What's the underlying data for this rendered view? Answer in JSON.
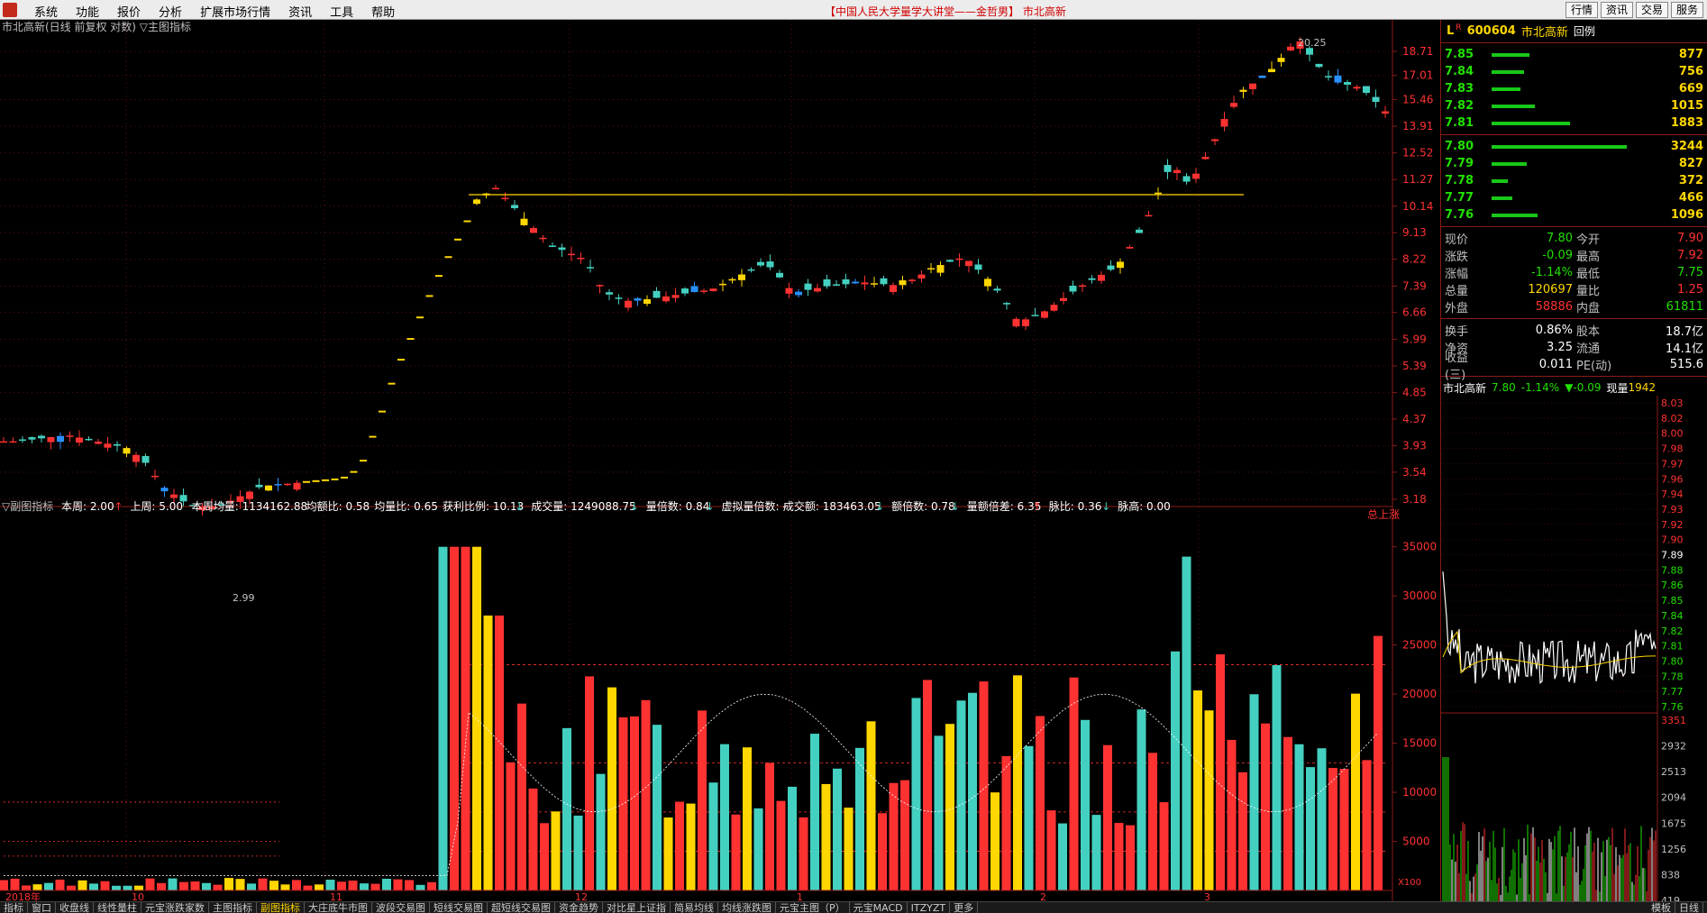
{
  "menubar": {
    "items": [
      "系统",
      "功能",
      "报价",
      "分析",
      "扩展市场行情",
      "资讯",
      "工具",
      "帮助"
    ],
    "title": "【中国人民大学量学大讲堂——金哲男】 市北高新",
    "right_buttons": [
      "行情",
      "资讯",
      "交易",
      "服务"
    ]
  },
  "main_chart": {
    "header": "市北高新(日线 前复权 对数) ▽主图指标",
    "high_label": "20.25",
    "low_label": "2.99",
    "price_ticks": [
      "18.71",
      "17.01",
      "15.46",
      "13.91",
      "12.52",
      "11.27",
      "10.14",
      "9.13",
      "8.22",
      "7.39",
      "6.66",
      "5.99",
      "5.39",
      "4.85",
      "4.37",
      "3.93",
      "3.54",
      "3.18"
    ],
    "date_labels": [
      "2018年",
      "10",
      "11",
      "12",
      "1",
      "2",
      "3"
    ]
  },
  "sub_chart": {
    "header_name": "▽副图指标",
    "header_items": [
      {
        "text": "本周: 2.00",
        "mark": "↑",
        "color": "#ffffff"
      },
      {
        "text": "上周: 5.00",
        "mark": "",
        "color": "#ffffff"
      },
      {
        "text": "本周均量: 1134162.88",
        "mark": "",
        "color": "#ffffff"
      },
      {
        "text": "均额比: 0.58",
        "mark": "",
        "color": "#ffffff"
      },
      {
        "text": "均量比: 0.65",
        "mark": "",
        "color": "#ffffff"
      },
      {
        "text": "获利比例: 10.13",
        "mark": "↓",
        "color": "#ffffff"
      },
      {
        "text": "成交量: 1249088.75",
        "mark": "↓",
        "color": "#ffffff"
      },
      {
        "text": "量倍数: 0.84",
        "mark": "↓",
        "color": "#ffffff"
      },
      {
        "text": "虚拟量倍数: -",
        "mark": "",
        "color": "#ffffff"
      },
      {
        "text": "成交额: 183463.05",
        "mark": "↓",
        "color": "#ffffff"
      },
      {
        "text": "额倍数: 0.78",
        "mark": "↓",
        "color": "#ffffff"
      },
      {
        "text": "量额倍差: 6.35",
        "mark": "↑",
        "color": "#ffffff"
      },
      {
        "text": "脉比: 0.36",
        "mark": "↓",
        "color": "#ffffff"
      },
      {
        "text": "脉高: 0.00",
        "mark": "",
        "color": "#ffffff"
      }
    ],
    "corner_label": "总上涨",
    "vol_ticks": [
      "35000",
      "30000",
      "25000",
      "20000",
      "15000",
      "10000",
      "5000"
    ],
    "unit_label": "X100"
  },
  "quote": {
    "market_flag": "L",
    "r_flag": "R",
    "code": "600604",
    "name": "市北高新",
    "mode": "回例",
    "asks": [
      {
        "price": "7.85",
        "vol": "877",
        "bar": 0.28
      },
      {
        "price": "7.84",
        "vol": "756",
        "bar": 0.24
      },
      {
        "price": "7.83",
        "vol": "669",
        "bar": 0.21
      },
      {
        "price": "7.82",
        "vol": "1015",
        "bar": 0.32
      },
      {
        "price": "7.81",
        "vol": "1883",
        "bar": 0.58
      }
    ],
    "bids": [
      {
        "price": "7.80",
        "vol": "3244",
        "bar": 1.0
      },
      {
        "price": "7.79",
        "vol": "827",
        "bar": 0.26
      },
      {
        "price": "7.78",
        "vol": "372",
        "bar": 0.12
      },
      {
        "price": "7.77",
        "vol": "466",
        "bar": 0.15
      },
      {
        "price": "7.76",
        "vol": "1096",
        "bar": 0.34
      }
    ],
    "stats1": [
      {
        "k": "现价",
        "v": "7.80",
        "vc": "grn",
        "k2": "今开",
        "v2": "7.90",
        "v2c": "red"
      },
      {
        "k": "涨跌",
        "v": "-0.09",
        "vc": "grn",
        "k2": "最高",
        "v2": "7.92",
        "v2c": "red"
      },
      {
        "k": "涨幅",
        "v": "-1.14%",
        "vc": "grn",
        "k2": "最低",
        "v2": "7.75",
        "v2c": "grn"
      },
      {
        "k": "总量",
        "v": "120697",
        "vc": "yel",
        "k2": "量比",
        "v2": "1.25",
        "v2c": "red"
      },
      {
        "k": "外盘",
        "v": "58886",
        "vc": "red",
        "k2": "内盘",
        "v2": "61811",
        "v2c": "grn"
      }
    ],
    "stats2": [
      {
        "k": "换手",
        "v": "0.86%",
        "vc": "wht",
        "k2": "股本",
        "v2": "18.7亿",
        "v2c": "wht"
      },
      {
        "k": "净资",
        "v": "3.25",
        "vc": "wht",
        "k2": "流通",
        "v2": "14.1亿",
        "v2c": "wht"
      },
      {
        "k": "收益(三)",
        "v": "0.011",
        "vc": "wht",
        "k2": "PE(动)",
        "v2": "515.6",
        "v2c": "wht"
      }
    ],
    "mini_header": {
      "name": "市北高新",
      "price": "7.80",
      "pct": "-1.14%",
      "chg": "▼-0.09",
      "now_label": "现量",
      "now_vol": "1942"
    },
    "mini_price_ticks": [
      "8.03",
      "8.02",
      "8.00",
      "7.98",
      "7.97",
      "7.96",
      "7.94",
      "7.93",
      "7.92",
      "7.90",
      "7.89",
      "7.88",
      "7.86",
      "7.85",
      "7.84",
      "7.82",
      "7.81",
      "7.80",
      "7.78",
      "7.77",
      "7.76"
    ],
    "mini_vol_ticks": [
      "3351",
      "2932",
      "2513",
      "2094",
      "1675",
      "1256",
      "838",
      "419"
    ]
  },
  "bottombar": {
    "tabs": [
      "指标",
      "窗口",
      "收盘线",
      "线性量柱",
      "元宝涨跌家数",
      "主图指标",
      "副图指标",
      "大庄底牛市图",
      "波段交易图",
      "短线交易图",
      "超短线交易图",
      "资金趋势",
      "对比星上证指",
      "简易均线",
      "均线涨跌图",
      "元宝主图（P）",
      "元宝MACD",
      "ITZYZT",
      "更多"
    ],
    "active": "副图指标",
    "right": [
      "模板",
      "日线"
    ]
  },
  "colors": {
    "up": "#ff3232",
    "down": "#44d0c0",
    "gold": "#ffd700",
    "axis": "#8c1a1a",
    "grid": "#5a1010"
  }
}
